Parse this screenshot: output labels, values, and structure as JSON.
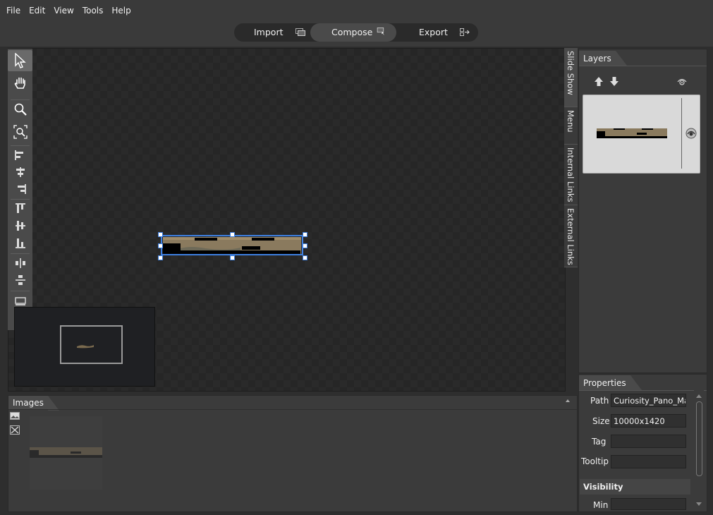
{
  "menu": {
    "items": [
      "File",
      "Edit",
      "View",
      "Tools",
      "Help"
    ]
  },
  "modes": {
    "import": "Import",
    "compose": "Compose",
    "export": "Export",
    "active": "Compose"
  },
  "side_tabs": [
    "Slide Show",
    "Menu",
    "Internal Links",
    "External Links"
  ],
  "layers": {
    "title": "Layers"
  },
  "properties": {
    "title": "Properties",
    "path_label": "Path",
    "path_value": "Curiosity_Pano_Mars",
    "size_label": "Size",
    "size_value": "10000x1420",
    "tag_label": "Tag",
    "tag_value": "",
    "tooltip_label": "Tooltip",
    "tooltip_value": "",
    "visibility_header": "Visibility",
    "min_label": "Min",
    "min_value": ""
  },
  "images": {
    "title": "Images"
  },
  "colors": {
    "selection": "#3d7fe0",
    "panel": "#3b3b3b",
    "canvas": "#2a2a2a",
    "panorama": "#8a7a5e"
  },
  "icons": {
    "tools": [
      "cursor-icon",
      "hand-icon",
      "zoom-icon",
      "zoom-fit-icon",
      "align-left-icon",
      "align-center-icon",
      "align-right-icon",
      "align-top-icon",
      "align-middle-icon",
      "align-bottom-icon",
      "distribute-horizontal-icon",
      "distribute-vertical-icon",
      "fit-width-icon",
      "fit-height-icon"
    ]
  }
}
